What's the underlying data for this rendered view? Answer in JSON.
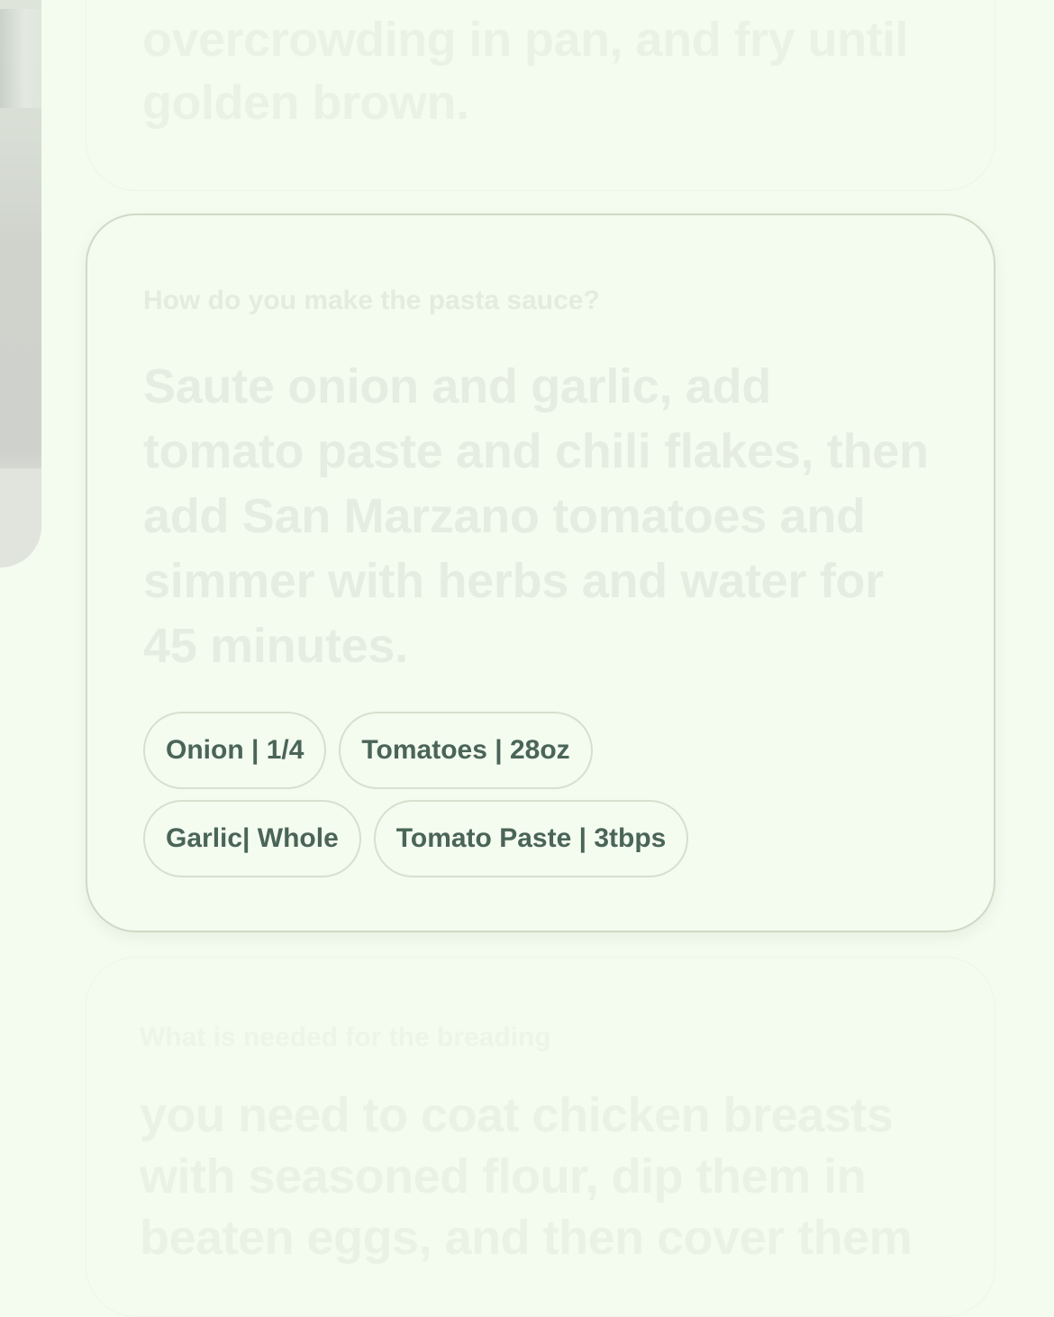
{
  "cards": {
    "previous": {
      "answer_line1": "overcrowding in pan, and fry until",
      "answer_line2": "golden brown."
    },
    "current": {
      "question": "How do you make the pasta sauce?",
      "answer": "Saute onion and garlic, add tomato paste and chili flakes, then add San Marzano tomatoes and simmer with herbs and water for 45 minutes.",
      "ingredients": [
        "Onion | 1/4",
        "Tomatoes | 28oz",
        "Garlic| Whole",
        "Tomato Paste | 3tbps"
      ]
    },
    "next": {
      "question": "What is needed for the breading",
      "answer_line1": "you need to coat chicken breasts",
      "answer_line2": "with seasoned flour, dip them in",
      "answer_line3": "beaten eggs, and then cover them"
    }
  },
  "colors": {
    "background": "#f4fbef",
    "chip_text": "#4a6558",
    "chip_border": "#d6e0ce",
    "card_border": "#cfdac6",
    "faded_text": "#e6ece1"
  }
}
